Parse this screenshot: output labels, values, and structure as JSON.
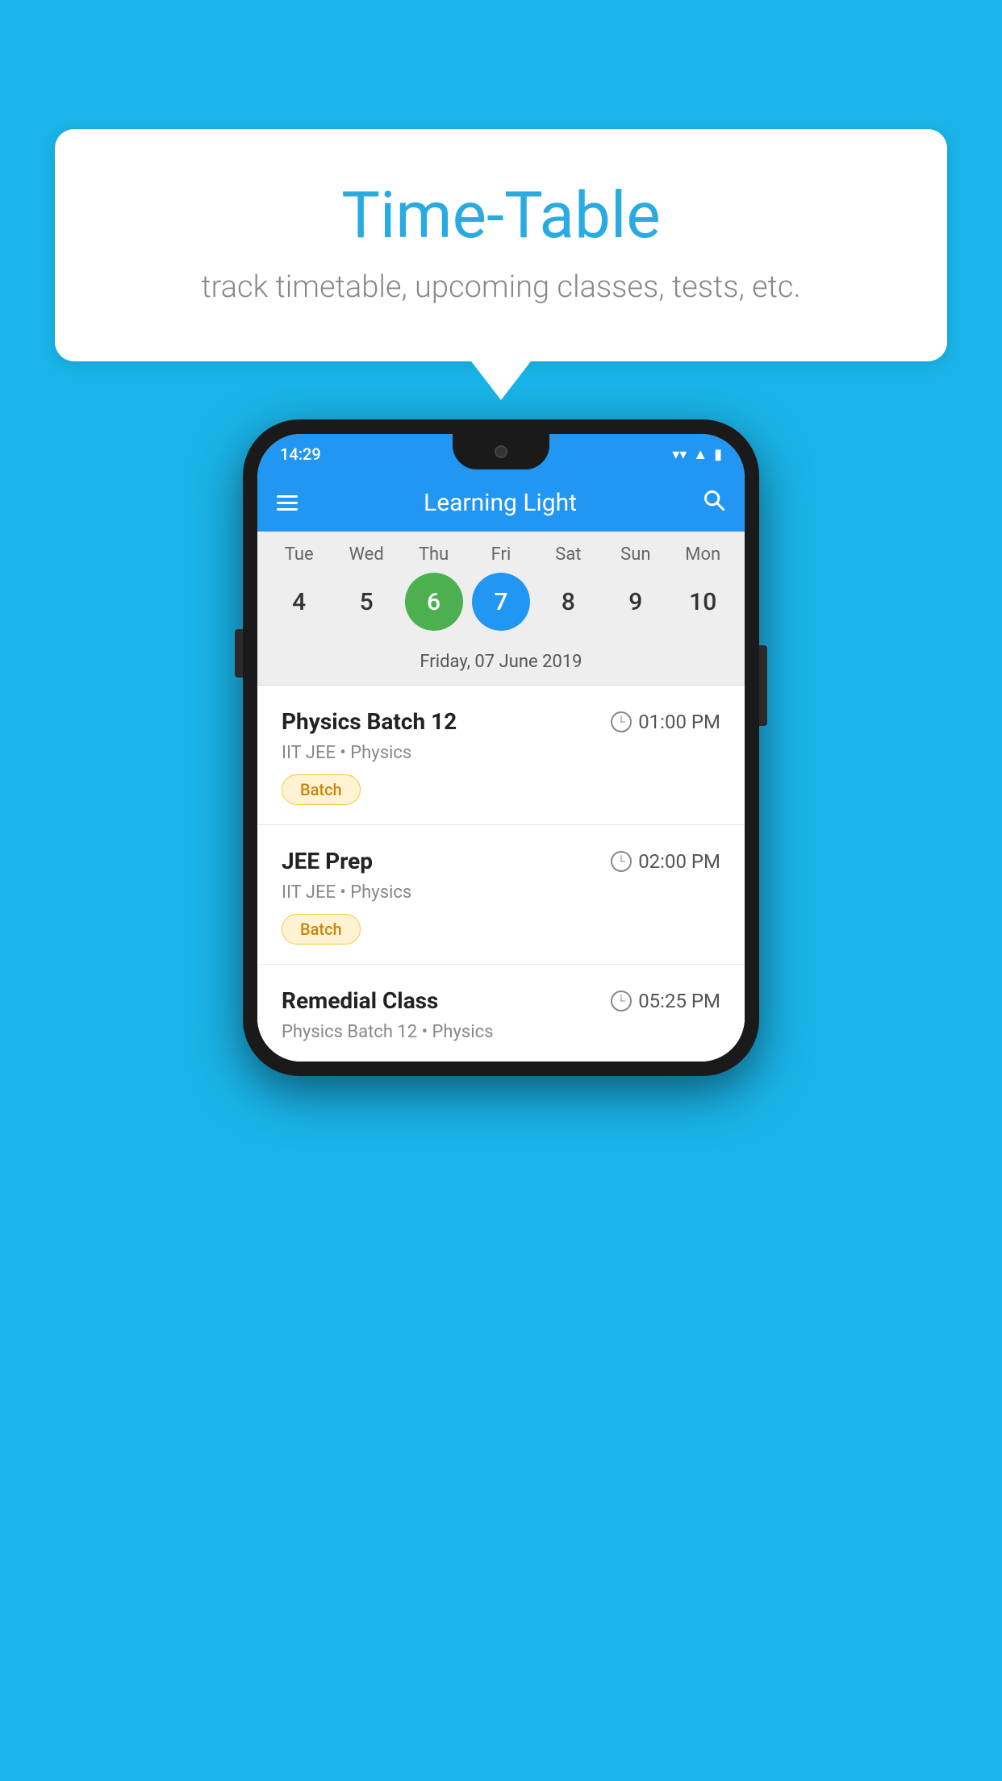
{
  "background_color": "#1ab4e8",
  "speech_bubble": {
    "title": "Time-Table",
    "subtitle": "track timetable, upcoming classes, tests, etc."
  },
  "phone": {
    "status_bar": {
      "time": "14:29",
      "icons": [
        "wifi",
        "signal",
        "battery"
      ]
    },
    "app_header": {
      "title": "Learning Light",
      "menu_label": "menu",
      "search_label": "search"
    },
    "calendar": {
      "days": [
        {
          "name": "Tue",
          "num": "4",
          "state": "normal"
        },
        {
          "name": "Wed",
          "num": "5",
          "state": "normal"
        },
        {
          "name": "Thu",
          "num": "6",
          "state": "today"
        },
        {
          "name": "Fri",
          "num": "7",
          "state": "selected"
        },
        {
          "name": "Sat",
          "num": "8",
          "state": "normal"
        },
        {
          "name": "Sun",
          "num": "9",
          "state": "normal"
        },
        {
          "name": "Mon",
          "num": "10",
          "state": "normal"
        }
      ],
      "selected_date_label": "Friday, 07 June 2019"
    },
    "schedule_items": [
      {
        "title": "Physics Batch 12",
        "time": "01:00 PM",
        "subtitle": "IIT JEE • Physics",
        "tag": "Batch"
      },
      {
        "title": "JEE Prep",
        "time": "02:00 PM",
        "subtitle": "IIT JEE • Physics",
        "tag": "Batch"
      },
      {
        "title": "Remedial Class",
        "time": "05:25 PM",
        "subtitle": "Physics Batch 12 • Physics",
        "tag": null
      }
    ]
  }
}
